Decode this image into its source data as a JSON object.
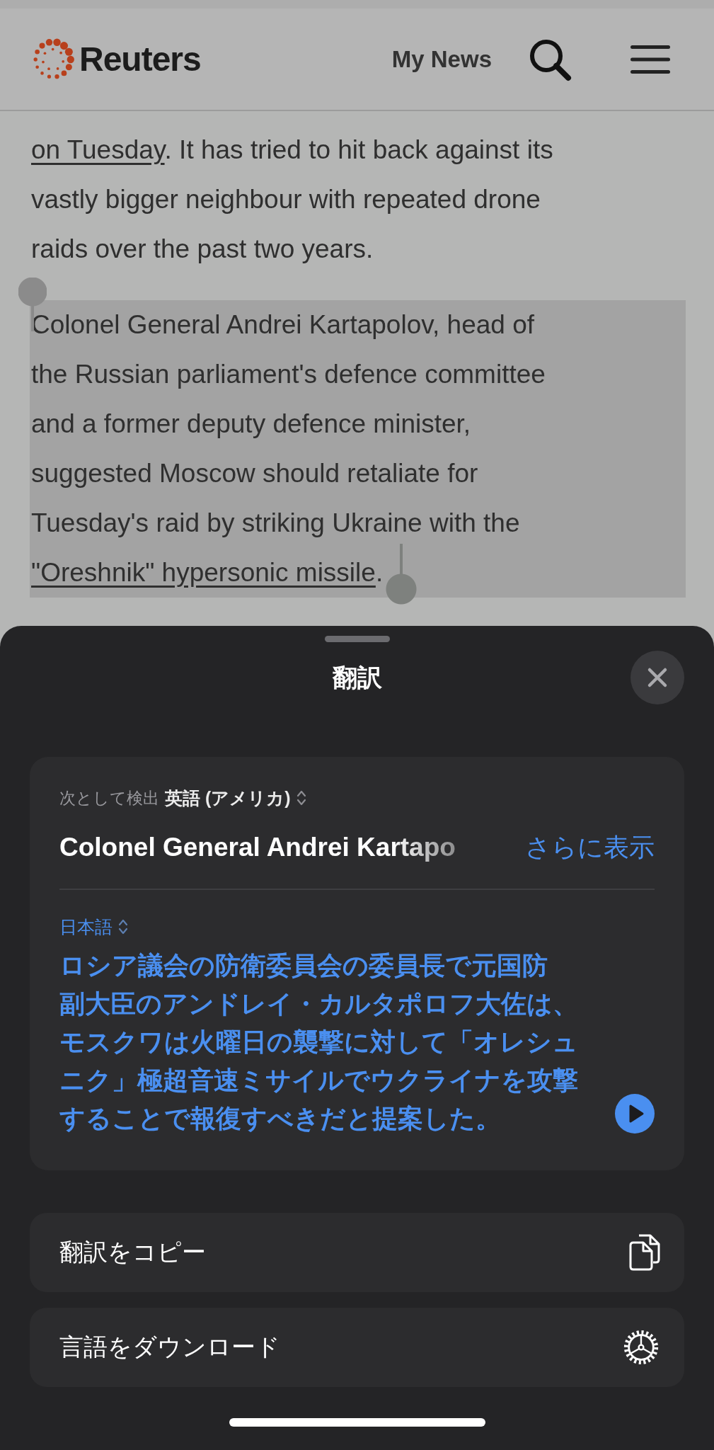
{
  "header": {
    "logo": "Reuters",
    "nav_link": "My News"
  },
  "article": {
    "paragraphs": [
      {
        "selected": false,
        "lines": [
          [
            {
              "text": "on Tuesday",
              "kind": "link"
            },
            {
              "text": ". It has tried to hit back against its",
              "kind": "text"
            }
          ],
          [
            {
              "text": "vastly bigger neighbour with repeated drone",
              "kind": "text"
            }
          ],
          [
            {
              "text": "raids over the past two years.",
              "kind": "text"
            }
          ]
        ]
      },
      {
        "selected": true,
        "lines": [
          [
            {
              "text": "Colonel General Andrei Kartapolov, head of",
              "kind": "text"
            }
          ],
          [
            {
              "text": "the Russian parliament's defence committee",
              "kind": "text"
            }
          ],
          [
            {
              "text": "and a former deputy defence minister,",
              "kind": "text"
            }
          ],
          [
            {
              "text": "suggested Moscow should retaliate for",
              "kind": "text"
            }
          ],
          [
            {
              "text": "Tuesday's raid by striking Ukraine with the",
              "kind": "text"
            }
          ],
          [
            {
              "text": "\"Oreshnik\" hypersonic missile",
              "kind": "link"
            },
            {
              "text": ".",
              "kind": "text"
            }
          ]
        ]
      }
    ]
  },
  "translate_sheet": {
    "title": "翻訳",
    "detected_label": "次として検出",
    "source_language": "英語 (アメリカ)",
    "source_text": "Colonel General Andrei Kartapo",
    "show_more": "さらに表示",
    "target_language": "日本語",
    "translation_lines": [
      "ロシア議会の防衛委員会の委員長で元国防",
      "副大臣のアンドレイ・カルタポロフ大佐は、",
      "モスクワは火曜日の襲撃に対して「オレシュ",
      "ニク」極超音速ミサイルでウクライナを攻撃",
      "することで報復すべきだと提案した。"
    ]
  },
  "actions": [
    {
      "label": "翻訳をコピー",
      "kind": "copy"
    },
    {
      "label": "言語をダウンロード",
      "kind": "download"
    }
  ]
}
